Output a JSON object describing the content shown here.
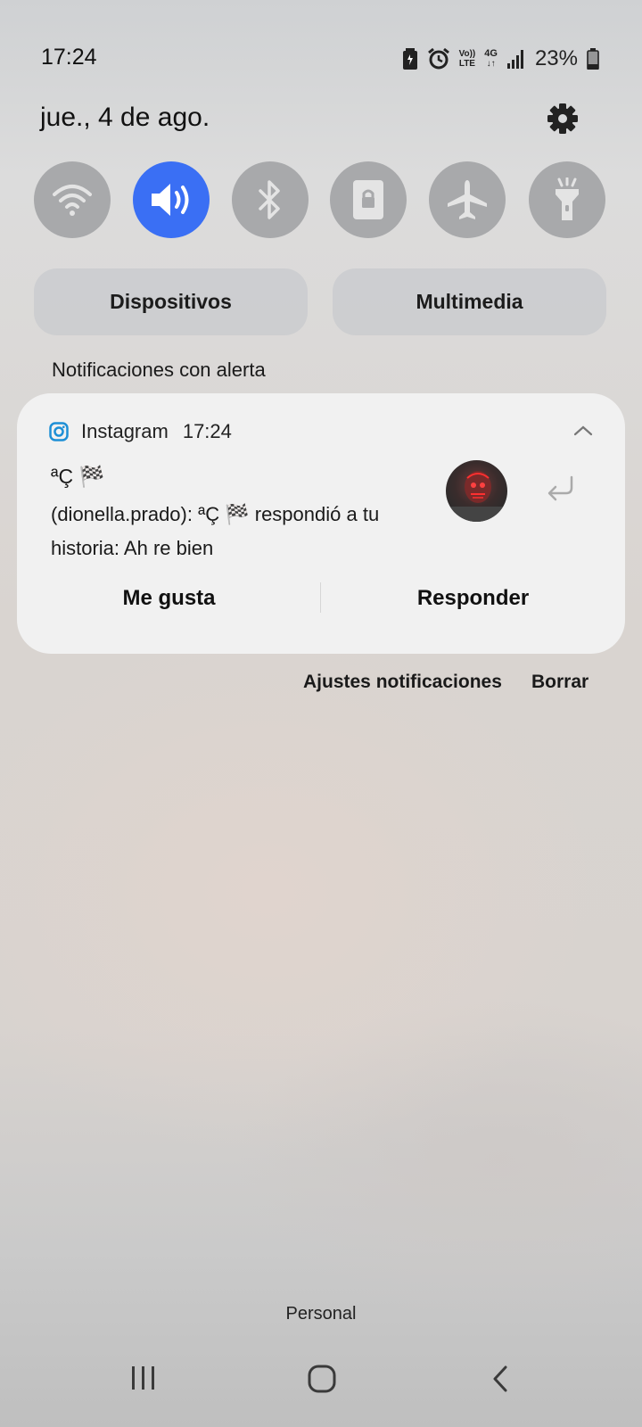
{
  "status_bar": {
    "time": "17:24",
    "battery_percent": "23%",
    "icons": [
      "battery-saver-icon",
      "alarm-icon",
      "volte-icon",
      "4g-icon",
      "signal-icon",
      "battery-icon"
    ],
    "volte_top": "Vo))",
    "volte_bottom": "LTE",
    "network": "4G"
  },
  "header": {
    "date": "jue., 4 de ago.",
    "settings_icon": "gear-icon"
  },
  "quick_toggles": [
    {
      "name": "wifi",
      "icon": "wifi-icon",
      "active": false
    },
    {
      "name": "sound",
      "icon": "volume-icon",
      "active": true
    },
    {
      "name": "bluetooth",
      "icon": "bluetooth-icon",
      "active": false
    },
    {
      "name": "rotation-lock",
      "icon": "portrait-lock-icon",
      "active": false
    },
    {
      "name": "airplane",
      "icon": "airplane-icon",
      "active": false
    },
    {
      "name": "flashlight",
      "icon": "flashlight-icon",
      "active": false
    }
  ],
  "panels": {
    "devices_label": "Dispositivos",
    "media_label": "Multimedia"
  },
  "section_label": "Notificaciones con alerta",
  "notification": {
    "app_name": "Instagram",
    "time": "17:24",
    "title": "ªÇ 🏁",
    "body": "(dionella.prado): ªÇ 🏁 respondió a tu historia: Ah re bien",
    "like_label": "Me gusta",
    "reply_label": "Responder"
  },
  "footer_links": {
    "settings_label": "Ajustes notificaciones",
    "clear_label": "Borrar"
  },
  "profile_label": "Personal",
  "colors": {
    "accent": "#3a6ff4",
    "toggle_off": "#a8a9ab",
    "card": "#f1f1f1"
  }
}
